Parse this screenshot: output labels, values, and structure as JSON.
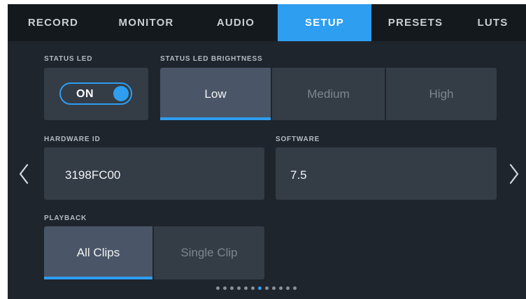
{
  "tabs": [
    {
      "label": "RECORD",
      "active": false
    },
    {
      "label": "MONITOR",
      "active": false
    },
    {
      "label": "AUDIO",
      "active": false
    },
    {
      "label": "SETUP",
      "active": true
    },
    {
      "label": "PRESETS",
      "active": false
    },
    {
      "label": "LUTS",
      "active": false
    }
  ],
  "status_led": {
    "label": "STATUS LED",
    "toggle_value": "ON",
    "enabled": true
  },
  "status_led_brightness": {
    "label": "STATUS LED BRIGHTNESS",
    "options": [
      "Low",
      "Medium",
      "High"
    ],
    "selected": "Low"
  },
  "hardware_id": {
    "label": "HARDWARE ID",
    "value": "3198FC00"
  },
  "software": {
    "label": "SOFTWARE",
    "value": "7.5"
  },
  "playback": {
    "label": "PLAYBACK",
    "options": [
      "All Clips",
      "Single Clip"
    ],
    "selected": "All Clips"
  },
  "pagination": {
    "total_pages": 12,
    "current_page": 7
  },
  "colors": {
    "accent": "#2e9ef0",
    "background": "#1f252c",
    "tile": "#343c46",
    "selected_tile": "#4a5667"
  },
  "icons": {
    "prev": "chevron-left-icon",
    "next": "chevron-right-icon"
  }
}
